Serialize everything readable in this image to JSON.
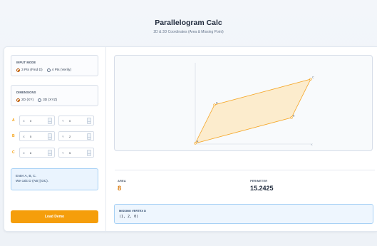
{
  "header": {
    "title": "Parallelogram Calc",
    "subtitle": "2D & 3D Coordinates (Area & Missing Point)"
  },
  "input_mode": {
    "label": "INPUT MODE",
    "options": [
      {
        "label": "3 Pts (Find D)",
        "selected": true
      },
      {
        "label": "4 Pts (Verify)",
        "selected": false
      }
    ]
  },
  "dimensions": {
    "label": "DIMENSIONS",
    "options": [
      {
        "label": "2D (XY)",
        "selected": true
      },
      {
        "label": "3D (XYZ)",
        "selected": false
      }
    ]
  },
  "vertices": [
    {
      "name": "A",
      "x_label": "X",
      "x": "0",
      "y_label": "Y",
      "y": "0"
    },
    {
      "name": "B",
      "x_label": "X",
      "x": "5",
      "y_label": "Y",
      "y": "2"
    },
    {
      "name": "C",
      "x_label": "X",
      "x": "6",
      "y_label": "Y",
      "y": "5"
    }
  ],
  "info": {
    "line1": "Enter A, B, C.",
    "line2": "We calc D (AB || DC)."
  },
  "demo_button": {
    "label": "Load Demo"
  },
  "plot": {
    "x_axis_label": "X",
    "points": [
      {
        "label": "A",
        "x": 0,
        "y": 0
      },
      {
        "label": "B",
        "x": 5,
        "y": 2
      },
      {
        "label": "C",
        "x": 6,
        "y": 5
      },
      {
        "label": "D",
        "x": 1,
        "y": 3
      }
    ],
    "fill_color": "#fde9c4",
    "stroke_color": "#f5a524"
  },
  "results": {
    "area_label": "AREA",
    "area_value": "8",
    "perimeter_label": "PERIMETER",
    "perimeter_value": "15.2425",
    "missing_label": "MISSING VERTEX D",
    "missing_value": "(1, 2, 0)"
  },
  "colors": {
    "accent": "#f59e0b",
    "area_value": "#d97706",
    "info_bg": "#eaf4fe"
  }
}
